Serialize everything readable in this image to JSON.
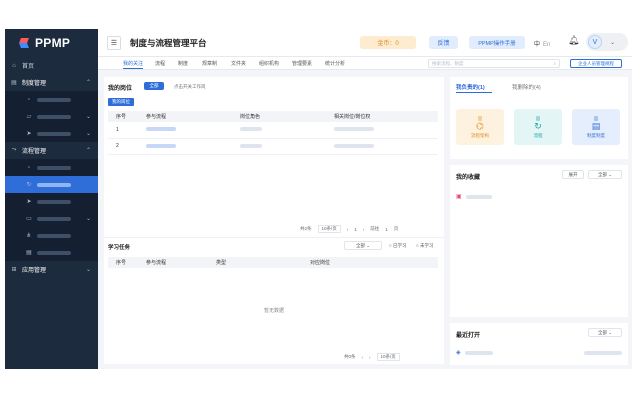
{
  "app": {
    "name": "PPMP",
    "title": "制度与流程管理平台"
  },
  "header": {
    "coin_label": "金币：0",
    "feedback_label": "反馈",
    "manual_label": "PPMP操作手册",
    "lang_zh": "中",
    "lang_en": "En",
    "user_initial": "V"
  },
  "sidebar": {
    "home": "首页",
    "system_mgmt": "制度管理",
    "process_mgmt": "流程管理",
    "app_mgmt": "应用管理"
  },
  "tabs": [
    "我的关注",
    "流程",
    "制度",
    "规章制",
    "文件夹",
    "组织机构",
    "管理要素",
    "统计分析"
  ],
  "search": {
    "placeholder": "搜索流程、制度"
  },
  "add_button": "企业人员管理规程",
  "positions": {
    "title": "我的岗位",
    "badge": "全部",
    "link": "点击开关工作岗",
    "ribbon": "我的岗位",
    "columns": [
      "序号",
      "参与流程",
      "岗位角色",
      "相关岗位/岗位权"
    ],
    "rows": [
      {
        "no": "1"
      },
      {
        "no": "2"
      }
    ],
    "pager": {
      "total": "共2条",
      "page_size": "10条/页",
      "page": "1",
      "goto": "前往",
      "page_input": "1",
      "page_unit": "页"
    }
  },
  "tasks": {
    "title": "学习任务",
    "filter": "全部",
    "learned": "已学习",
    "not_learned": "未学习",
    "columns": [
      "序号",
      "参与流程",
      "类型",
      "对应岗位"
    ],
    "empty": "暂无数据",
    "pager": {
      "total": "共0条",
      "page_size": "10条/页"
    }
  },
  "responsible": {
    "tab_active": "我负责的(1)",
    "tab_other": "我删除的(4)",
    "cards": [
      {
        "label": "流程架构",
        "icon": "hierarchy-icon",
        "color": "#e48b18",
        "bg": "#fdf1e0"
      },
      {
        "label": "流程",
        "icon": "cycle-icon",
        "color": "#19a3a3",
        "bg": "#e3f5f5"
      },
      {
        "label": "制度制度",
        "icon": "document-icon",
        "color": "#3a73d8",
        "bg": "#e5eefc"
      }
    ]
  },
  "favorites": {
    "title": "我的收藏",
    "mode": "展开",
    "filter": "全部"
  },
  "recent": {
    "title": "最近打开",
    "filter": "全部"
  }
}
